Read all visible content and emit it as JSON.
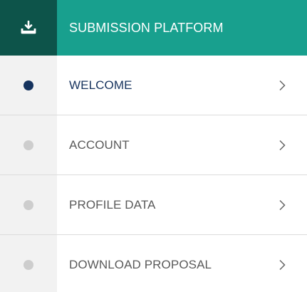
{
  "header": {
    "icon": "download-tray-icon",
    "title": "SUBMISSION PLATFORM",
    "colors": {
      "icon_bg": "#0d544a",
      "title_bg": "#18a08e"
    }
  },
  "menu": {
    "items": [
      {
        "label": "WELCOME",
        "active": true,
        "icon": "chevron-right-icon"
      },
      {
        "label": "ACCOUNT",
        "active": false,
        "icon": "chevron-right-icon"
      },
      {
        "label": "PROFILE DATA",
        "active": false,
        "icon": "chevron-right-icon"
      },
      {
        "label": "DOWNLOAD PROPOSAL",
        "active": false,
        "icon": "chevron-right-icon"
      }
    ],
    "colors": {
      "active_dot": "#15335e",
      "inactive_dot": "#cdcdcd"
    }
  }
}
